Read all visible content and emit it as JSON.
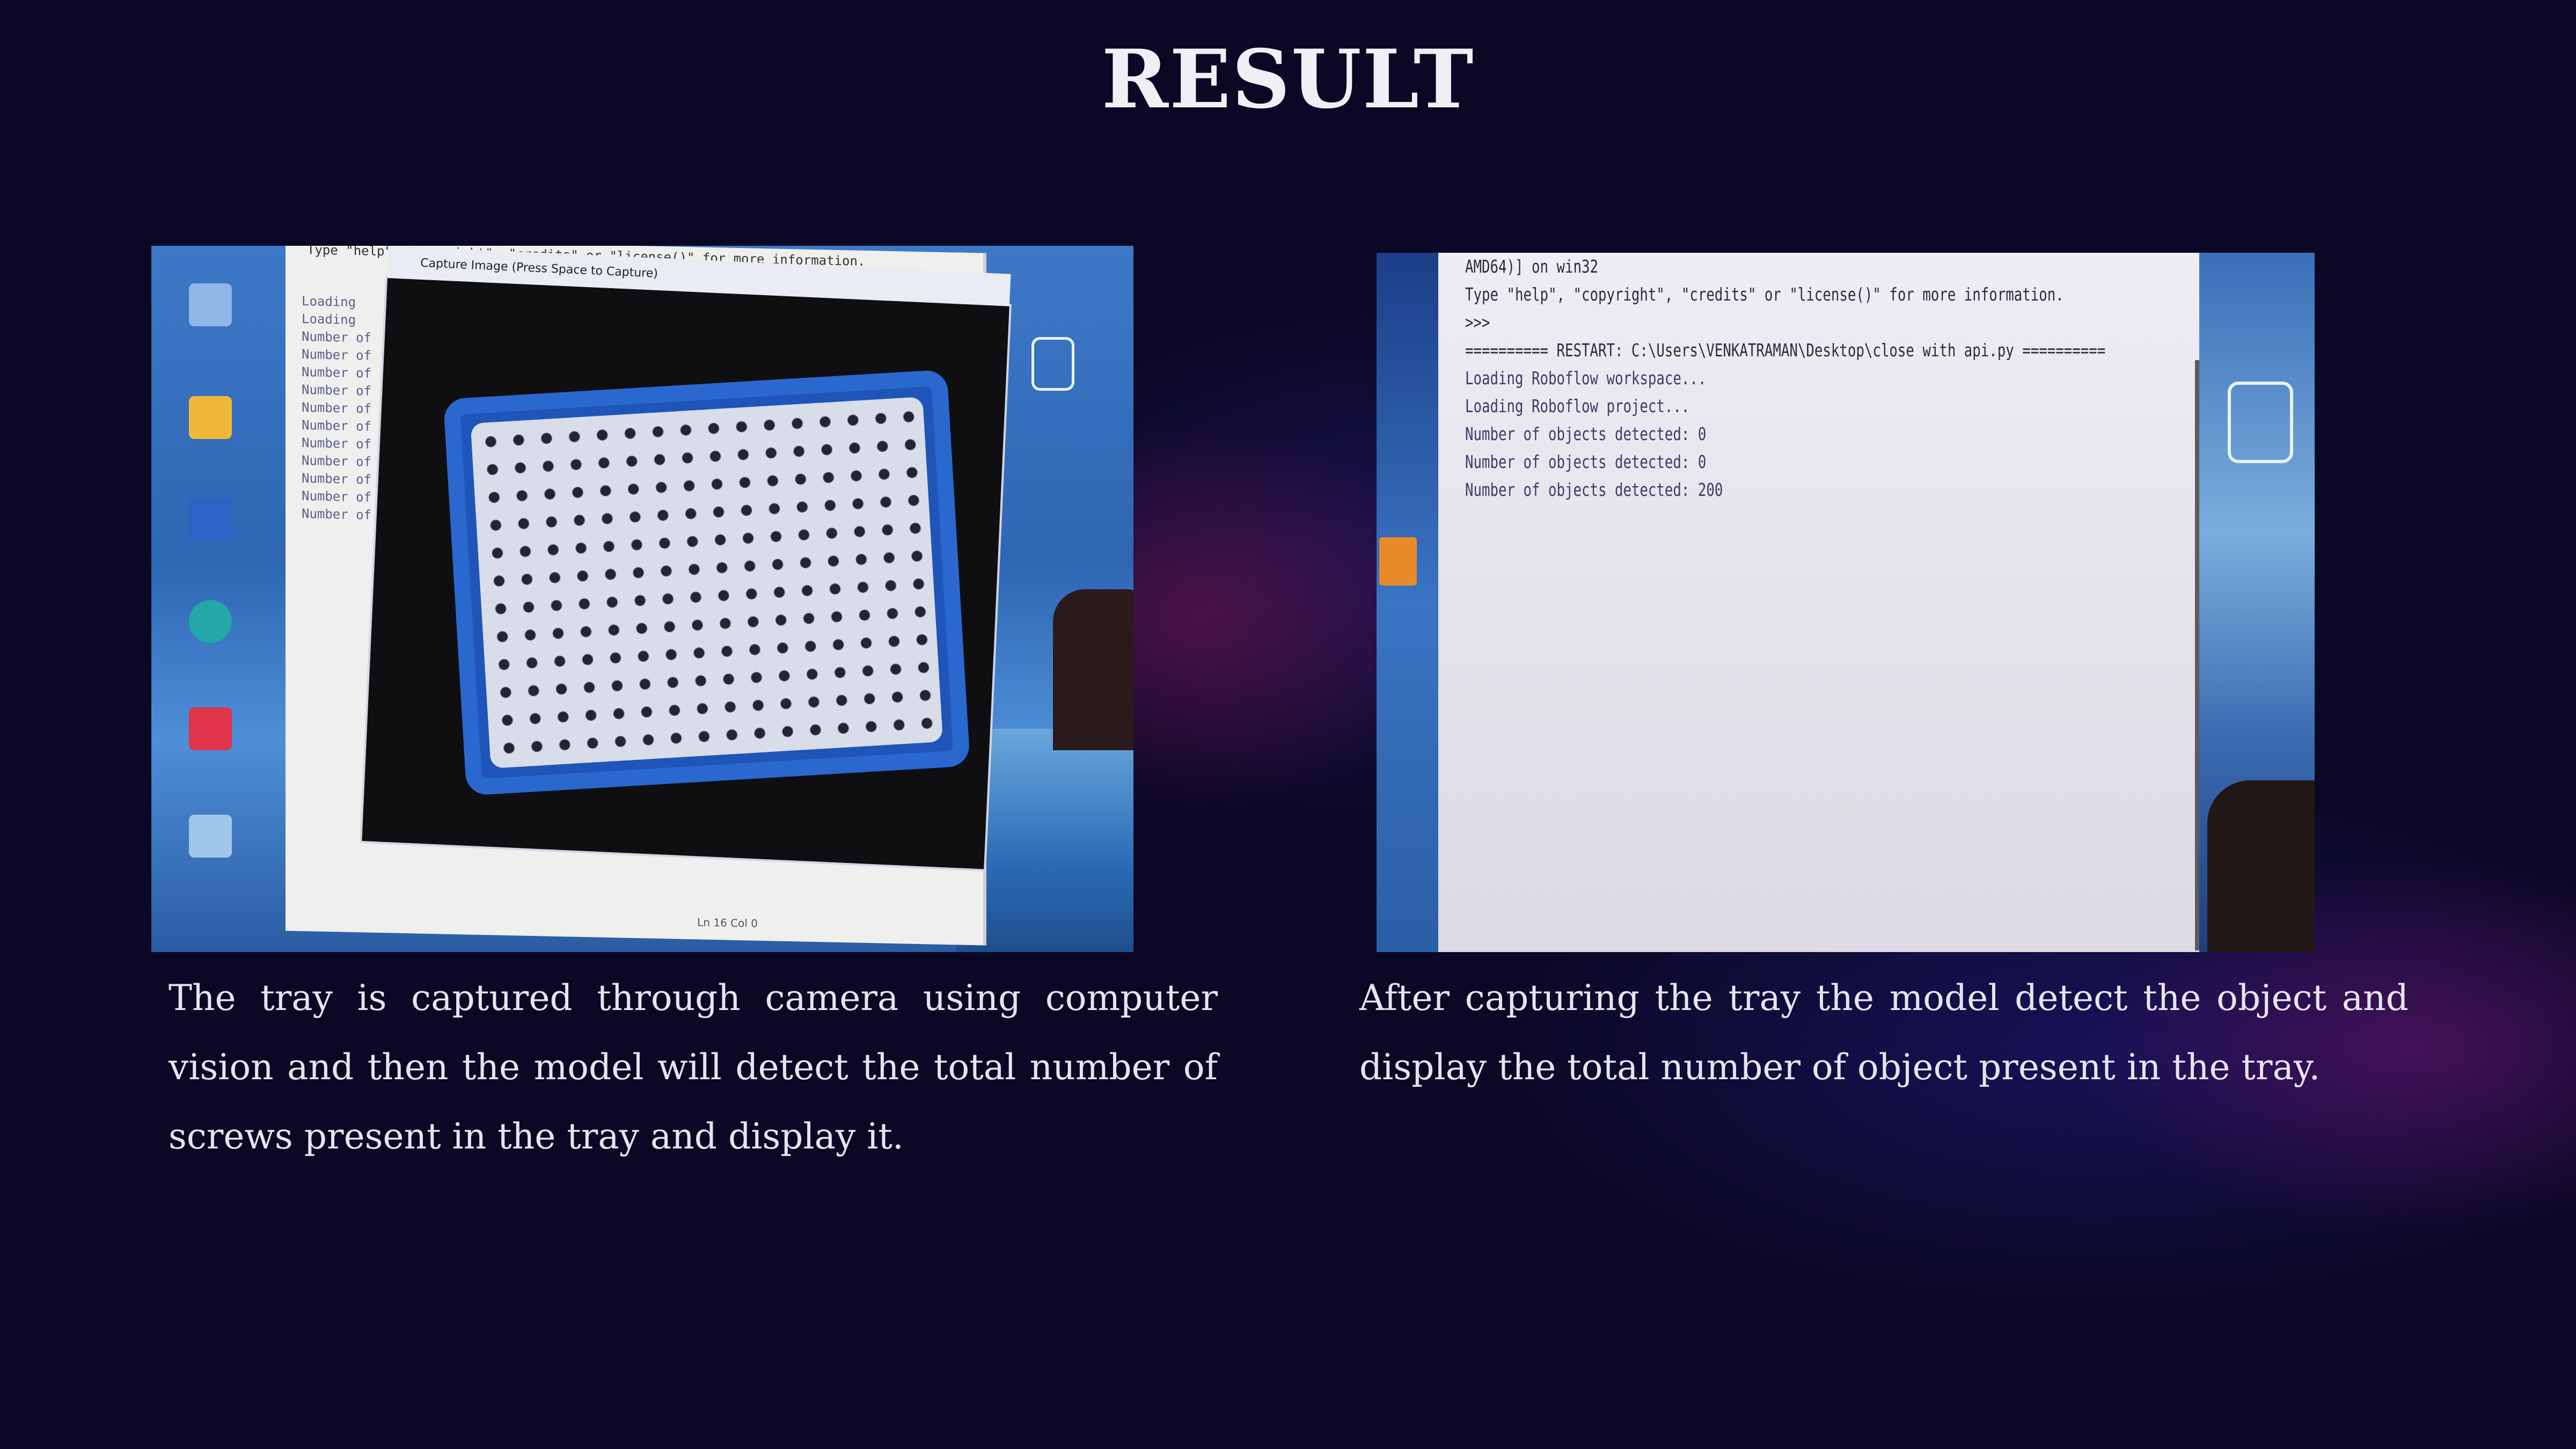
{
  "slide": {
    "title": "RESULT",
    "background_color": "#0b0826",
    "accent_glow_colors": [
      "#6e1450",
      "#281e78",
      "#6e146e"
    ]
  },
  "left_figure": {
    "shell_header": "Type \"help\", \"copyright\", \"credits\" or \"license()\" for more information.",
    "shell_lines": "Loading\nLoading\nNumber of\nNumber of\nNumber of\nNumber of\nNumber of\nNumber of\nNumber of\nNumber of\nNumber of\nNumber of\nNumber of",
    "capture_window_title": "Capture Image (Press Space to Capture)",
    "status_text": "Ln 16  Col 0",
    "caption": "The tray is captured through camera using computer vision and then the model will detect the total number of screws present in the tray and display it."
  },
  "right_figure": {
    "shell_lines": [
      "AMD64)] on win32",
      "Type \"help\", \"copyright\", \"credits\" or \"license()\" for more information.",
      ">>>",
      "========== RESTART: C:\\Users\\VENKATRAMAN\\Desktop\\close with api.py ==========",
      "Loading Roboflow workspace...",
      "Loading Roboflow project...",
      "Number of objects detected: 0",
      "Number of objects detected: 0",
      "Number of objects detected: 200"
    ],
    "caption": "After capturing the tray the model detect the object and display the total number of object present in the tray."
  }
}
